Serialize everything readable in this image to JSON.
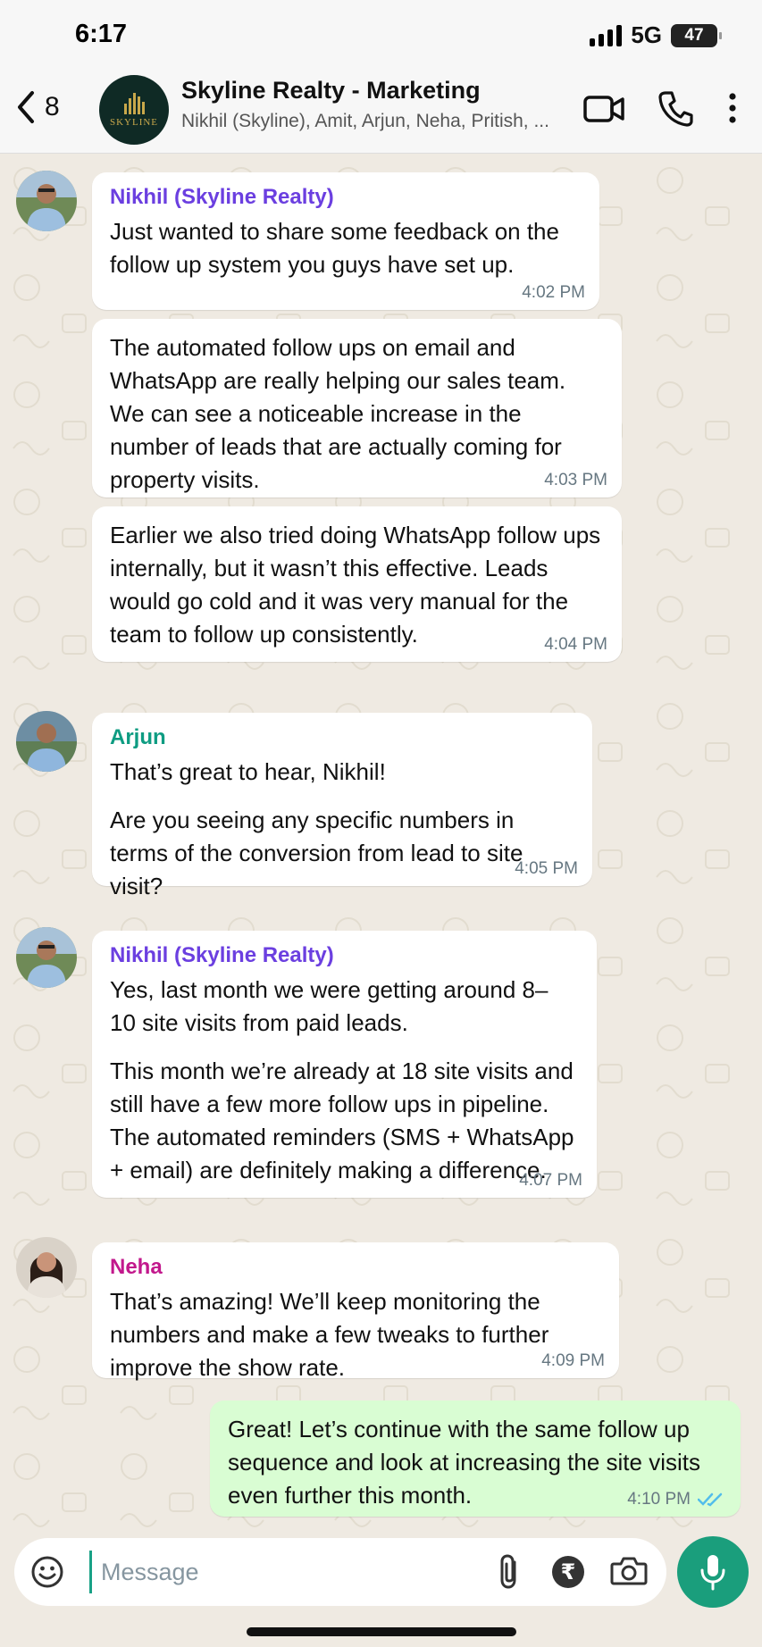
{
  "status_bar": {
    "time": "6:17",
    "network": "5G",
    "battery": "47"
  },
  "header": {
    "back_count": "8",
    "title": "Skyline Realty - Marketing",
    "subtitle": "Nikhil (Skyline), Amit, Arjun, Neha, Pritish, ...",
    "avatar_logo_text": "SKYLINE"
  },
  "messages": [
    {
      "sender": "Nikhil (Skyline Realty)",
      "sender_color": "#6b3fe0",
      "paragraphs": [
        "Just wanted to share some feedback on the follow up system you guys have set up."
      ],
      "time": "4:02 PM"
    },
    {
      "sender": "",
      "paragraphs": [
        "The automated follow ups on email and WhatsApp are really helping our sales team. We can see a noticeable increase in the number of leads that are actually coming for property visits."
      ],
      "time": "4:03 PM"
    },
    {
      "sender": "",
      "paragraphs": [
        "Earlier we also tried doing WhatsApp follow ups internally, but it wasn’t this effective. Leads would go cold and it was very manual for the team to follow up consistently."
      ],
      "time": "4:04 PM"
    },
    {
      "sender": "Arjun",
      "sender_color": "#0e9c82",
      "paragraphs": [
        "That’s great to hear, Nikhil!",
        "Are you seeing any specific numbers in terms of the conversion from lead to site visit?"
      ],
      "time": "4:05 PM"
    },
    {
      "sender": "Nikhil (Skyline Realty)",
      "sender_color": "#6b3fe0",
      "paragraphs": [
        "Yes, last month we were getting around 8–10 site visits from paid leads.",
        "This month we’re already at 18 site visits and still have a few more follow ups in pipeline. The automated reminders (SMS + WhatsApp + email) are definitely making a difference."
      ],
      "time": "4:07 PM"
    },
    {
      "sender": "Neha",
      "sender_color": "#c2188c",
      "paragraphs": [
        "That’s amazing! We’ll keep monitoring the numbers and make a few tweaks to further improve the show rate."
      ],
      "time": "4:09 PM"
    },
    {
      "sender": "",
      "paragraphs": [
        "Great! Let’s continue with the same follow up sequence and look at increasing the site visits even further this month."
      ],
      "time": "4:10 PM"
    }
  ],
  "composer": {
    "placeholder": "Message"
  },
  "icons": {
    "back": "chevron-left-icon",
    "video": "video-call-icon",
    "phone": "phone-icon",
    "more": "more-vertical-icon",
    "emoji": "emoji-icon",
    "attach": "paperclip-icon",
    "payment": "rupee-icon",
    "camera": "camera-icon",
    "mic": "microphone-icon",
    "read": "double-check-icon"
  },
  "colors": {
    "accent": "#1a9e7c",
    "outgoing_bubble": "#d9fdd3",
    "chat_bg": "#efeae2",
    "read_tick": "#53bdeb"
  }
}
